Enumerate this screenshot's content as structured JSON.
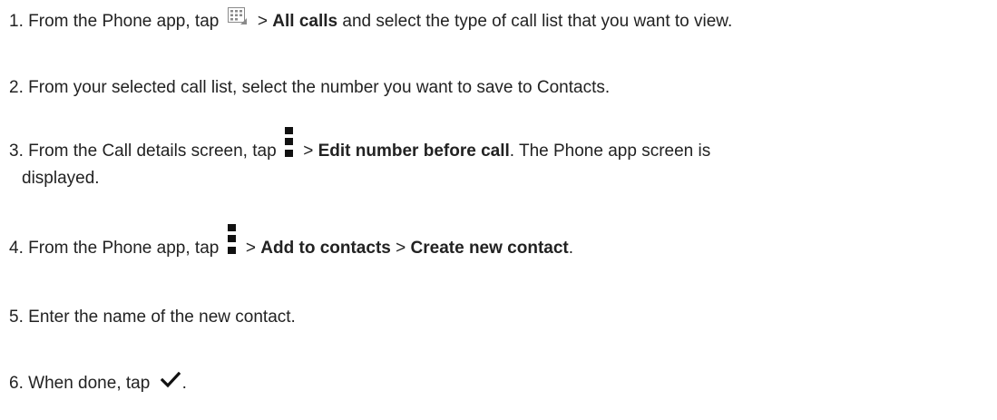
{
  "steps": [
    {
      "num": "1.",
      "text_a": "From the Phone app, tap",
      "icon": "dialpad-icon",
      "sep": ">",
      "bold_a": "All calls",
      "text_b": "and select the type of call list that you want to view."
    },
    {
      "num": "2.",
      "text_a": "From your selected call list, select the number you want to save to Contacts."
    },
    {
      "num": "3.",
      "text_a": "From the Call details screen, tap",
      "icon": "more-options-icon",
      "sep": ">",
      "bold_a": "Edit number before call",
      "text_b": ". The Phone app screen is",
      "text_c": "displayed."
    },
    {
      "num": "4.",
      "text_a": "From the Phone app, tap",
      "icon": "more-options-icon",
      "sep_a": ">",
      "bold_a": "Add to contacts",
      "sep_b": ">",
      "bold_b": "Create new contact",
      "text_b": "."
    },
    {
      "num": "5.",
      "text_a": "Enter the name of the new contact."
    },
    {
      "num": "6.",
      "text_a": "When done, tap",
      "icon": "checkmark-icon",
      "text_b": "."
    }
  ],
  "colors": {
    "text": "#222222",
    "icon": "#111111",
    "dialpad_icon": "#8a8a8a"
  }
}
